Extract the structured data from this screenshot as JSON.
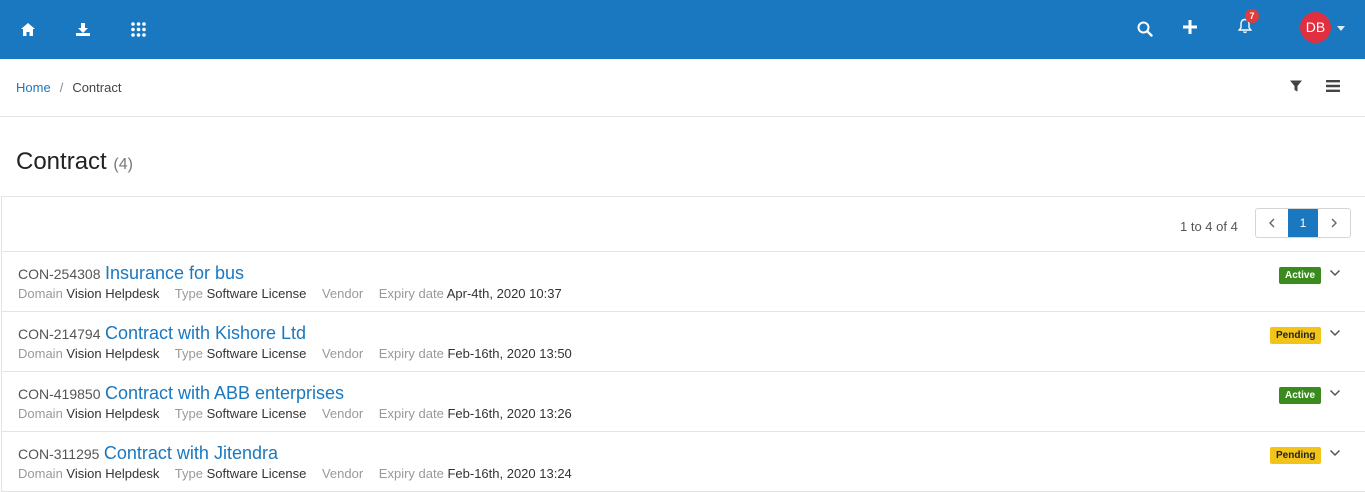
{
  "topbar": {
    "icons": [
      "home-icon",
      "download-icon",
      "apps-grid-icon",
      "search-icon",
      "plus-icon",
      "bell-icon"
    ],
    "notification_count": "7",
    "avatar_initials": "DB",
    "bg_color": "#1a78c0",
    "avatar_color": "#e0303f"
  },
  "breadcrumb": {
    "home": "Home",
    "separator": "/",
    "current": "Contract"
  },
  "page": {
    "title": "Contract",
    "count": "(4)"
  },
  "pagination": {
    "range": "1 to 4 of 4",
    "current_page": "1",
    "prev": "‹",
    "next": "›"
  },
  "labels": {
    "domain": "Domain",
    "type": "Type",
    "vendor": "Vendor",
    "expiry": "Expiry date"
  },
  "contracts": [
    {
      "id": "CON-254308",
      "title": "Insurance for bus",
      "domain": "Vision Helpdesk",
      "type": "Software License",
      "vendor": "",
      "expiry": "Apr-4th, 2020 10:37",
      "status": "Active"
    },
    {
      "id": "CON-214794",
      "title": "Contract with Kishore Ltd",
      "domain": "Vision Helpdesk",
      "type": "Software License",
      "vendor": "",
      "expiry": "Feb-16th, 2020 13:50",
      "status": "Pending"
    },
    {
      "id": "CON-419850",
      "title": "Contract with ABB enterprises",
      "domain": "Vision Helpdesk",
      "type": "Software License",
      "vendor": "",
      "expiry": "Feb-16th, 2020 13:26",
      "status": "Active"
    },
    {
      "id": "CON-311295",
      "title": "Contract with Jitendra",
      "domain": "Vision Helpdesk",
      "type": "Software License",
      "vendor": "",
      "expiry": "Feb-16th, 2020 13:24",
      "status": "Pending"
    }
  ],
  "status_colors": {
    "Active": "#3a8a1e",
    "Pending": "#f2c318"
  }
}
